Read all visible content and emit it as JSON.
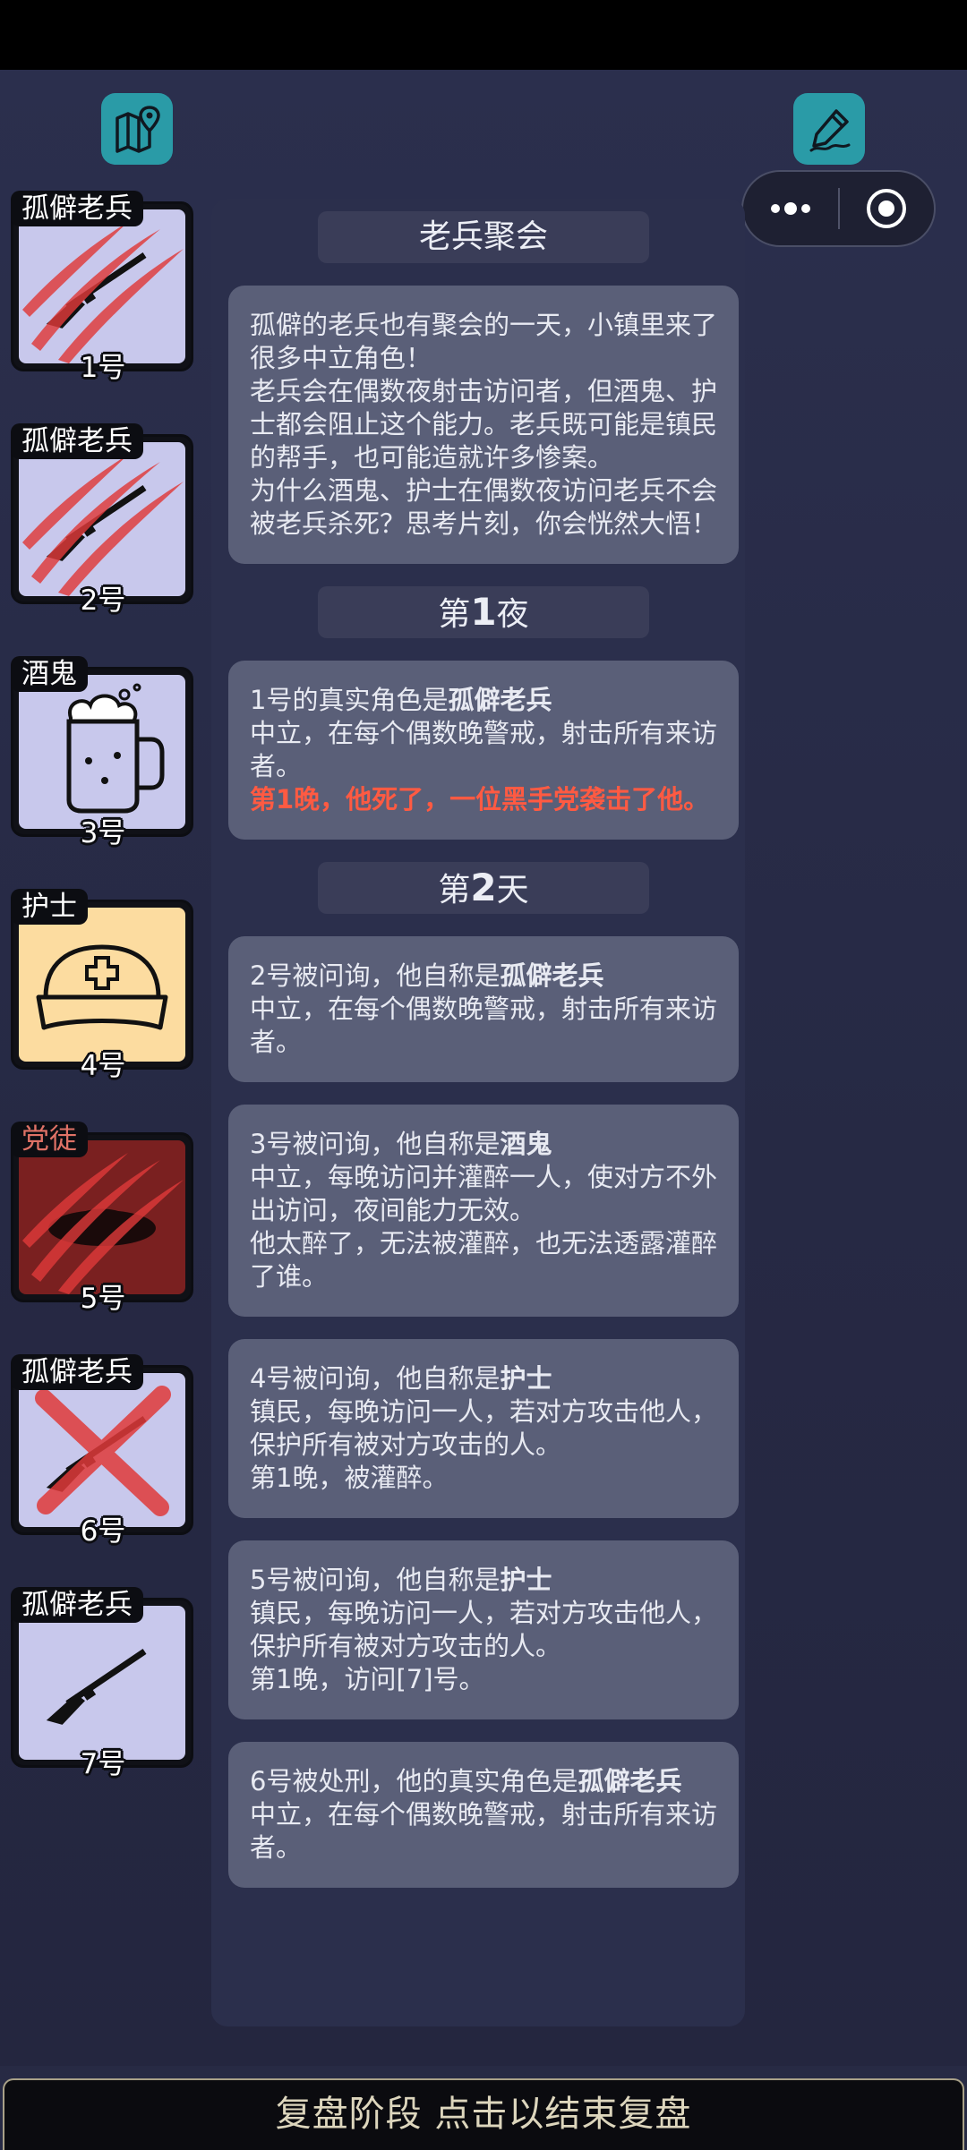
{
  "toolbar": {
    "map_icon": "map-pin-icon",
    "notes_icon": "pen-icon",
    "more_icon": "more-dots-icon",
    "close_icon": "target-icon",
    "brand_color": "#2a9ba7"
  },
  "players": [
    {
      "role": "孤僻老兵",
      "number": "1号",
      "icon": "rifle-icon",
      "state": "attacked"
    },
    {
      "role": "孤僻老兵",
      "number": "2号",
      "icon": "rifle-icon",
      "state": "attacked"
    },
    {
      "role": "酒鬼",
      "number": "3号",
      "icon": "beer-mug-icon",
      "state": "normal"
    },
    {
      "role": "护士",
      "number": "4号",
      "icon": "nurse-cap-icon",
      "state": "normal"
    },
    {
      "role": "党徒",
      "number": "5号",
      "icon": "hat-icon",
      "state": "attacked"
    },
    {
      "role": "孤僻老兵",
      "number": "6号",
      "icon": "rifle-icon",
      "state": "executed"
    },
    {
      "role": "孤僻老兵",
      "number": "7号",
      "icon": "rifle-icon",
      "state": "normal"
    }
  ],
  "log": {
    "intro_title": "老兵聚会",
    "intro_lines": [
      "孤僻的老兵也有聚会的一天，小镇里来了很多中立角色！",
      "老兵会在偶数夜射击访问者，但酒鬼、护士都会阻止这个能力。老兵既可能是镇民的帮手，也可能造就许多惨案。",
      "为什么酒鬼、护士在偶数夜访问老兵不会被老兵杀死？思考片刻，你会恍然大悟！"
    ],
    "night1": {
      "prefix": "第",
      "num": "1",
      "suffix": "夜"
    },
    "night1_entry": {
      "intro": "1号的真实角色是",
      "role": "孤僻老兵",
      "desc": "中立，在每个偶数晚警戒，射击所有来访者。",
      "death": "第1晚，他死了，一位黑手党袭击了他。"
    },
    "day2": {
      "prefix": "第",
      "num": "2",
      "suffix": "天"
    },
    "day2_entries": [
      {
        "intro": "2号被问询，他自称是",
        "role": "孤僻老兵",
        "lines": [
          "中立，在每个偶数晚警戒，射击所有来访者。"
        ]
      },
      {
        "intro": "3号被问询，他自称是",
        "role": "酒鬼",
        "lines": [
          "中立，每晚访问并灌醉一人，使对方不外出访问，夜间能力无效。",
          "他太醉了，无法被灌醉，也无法透露灌醉了谁。"
        ]
      },
      {
        "intro": "4号被问询，他自称是",
        "role": "护士",
        "lines": [
          "镇民，每晚访问一人，若对方攻击他人，保护所有被对方攻击的人。",
          "第1晚，被灌醉。"
        ]
      },
      {
        "intro": "5号被问询，他自称是",
        "role": "护士",
        "lines": [
          "镇民，每晚访问一人，若对方攻击他人，保护所有被对方攻击的人。",
          "第1晚，访问[7]号。"
        ]
      },
      {
        "intro": "6号被处刑，他的真实角色是",
        "role": "孤僻老兵",
        "lines": [
          "中立，在每个偶数晚警戒，射击所有来访者。"
        ]
      }
    ]
  },
  "footer": {
    "label": "复盘阶段 点击以结束复盘"
  }
}
